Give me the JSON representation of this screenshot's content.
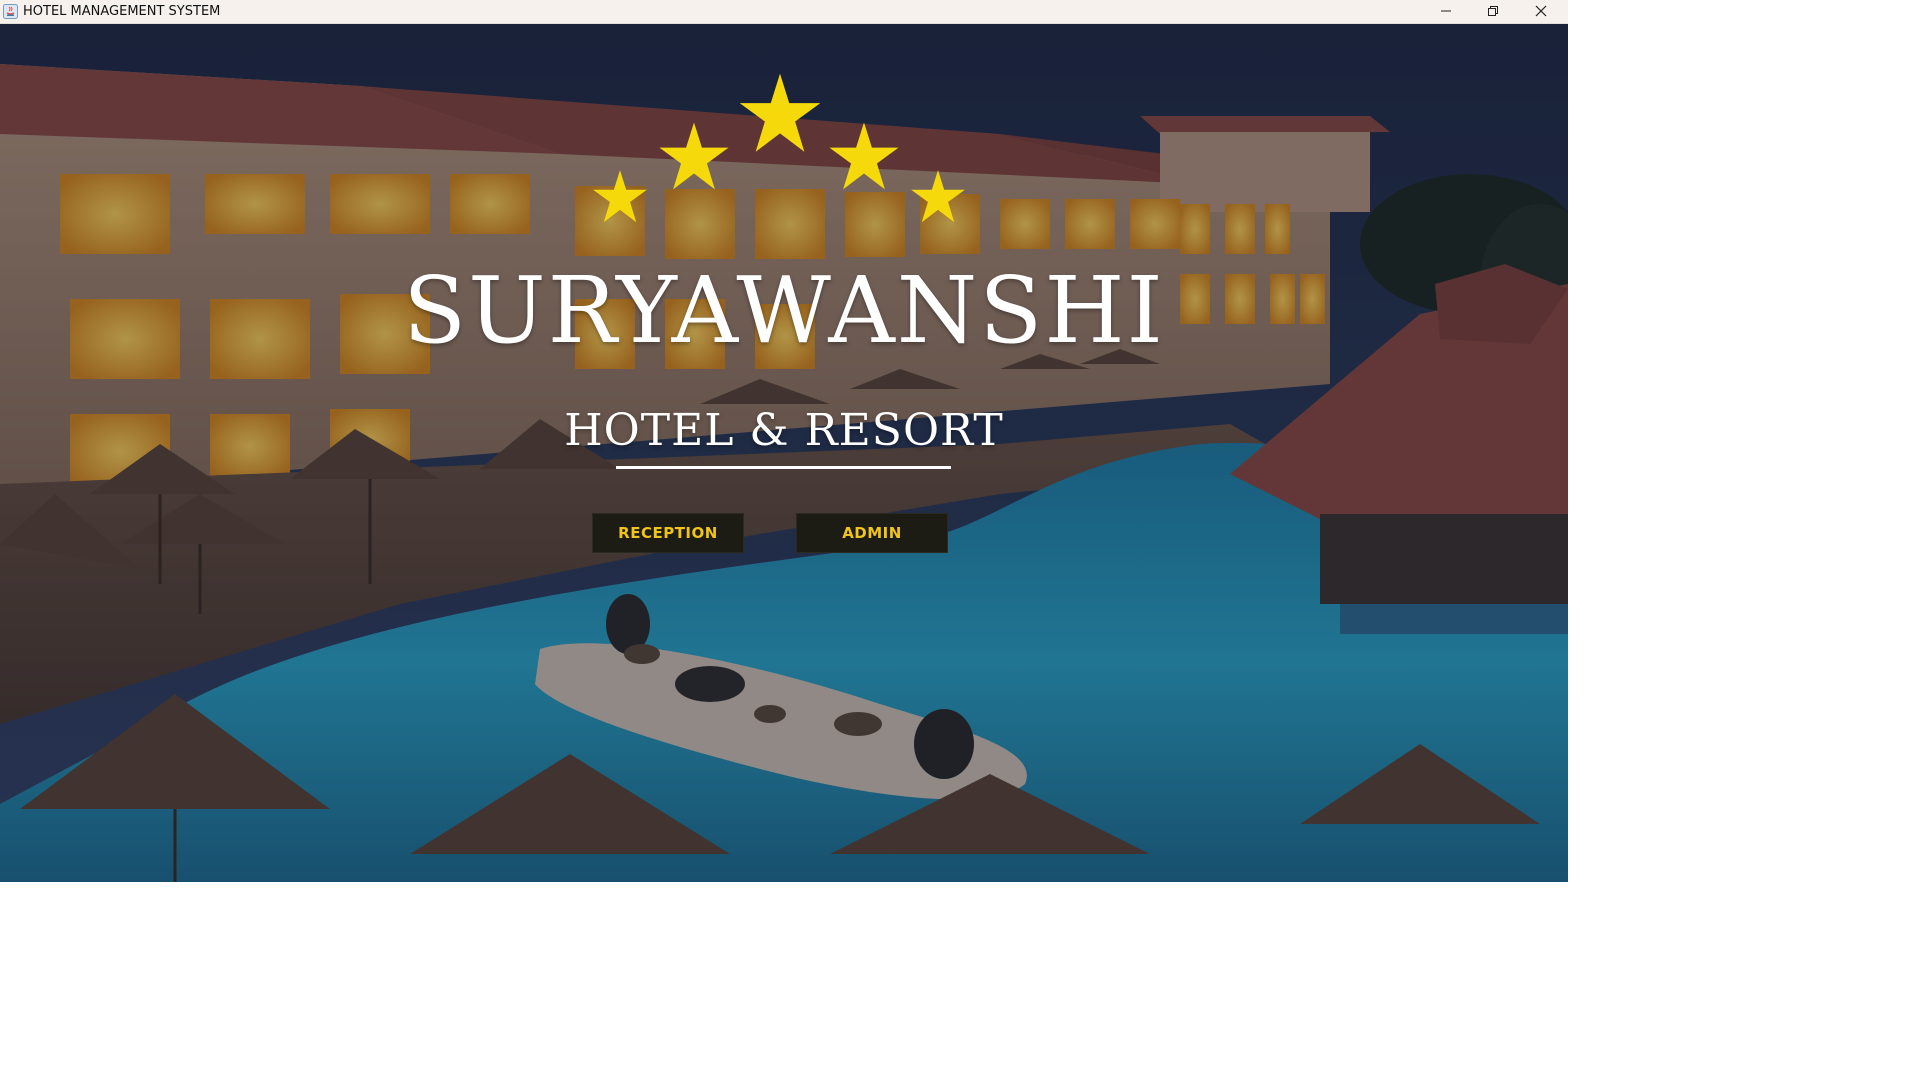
{
  "window": {
    "title": "HOTEL MANAGEMENT SYSTEM",
    "icons": [
      "java-app-icon",
      "minimize-icon",
      "maximize-icon",
      "close-icon"
    ]
  },
  "hero": {
    "stars": 5,
    "star_color": "#f5d90a",
    "brand_name": "SURYAWANSHI",
    "brand_subtitle": "HOTEL & RESORT"
  },
  "buttons": {
    "reception": "RECEPTION",
    "admin": "ADMIN"
  },
  "colors": {
    "button_bg": "#1c1b14",
    "button_text": "#f0c419",
    "titlebar_bg": "#f6f1ec"
  }
}
